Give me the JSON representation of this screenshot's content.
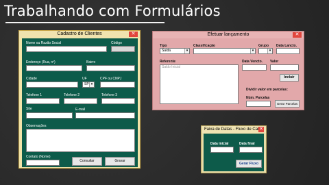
{
  "page": {
    "title": "Trabalhando com Formulários"
  },
  "cadastro": {
    "title": "Cadastro de Clientes",
    "close": "✕",
    "labels": {
      "nome": "Nome ou Razão Social",
      "codigo": "Código",
      "endereco": "Endereço (Rua, nº)",
      "bairro": "Bairro",
      "cidade": "Cidade",
      "uf": "UF",
      "cpf": "CPF ou CNPJ",
      "tel1": "Telefone 1",
      "tel2": "Telefone 2",
      "tel3": "Telefone 3",
      "site": "Site",
      "email": "E-mail",
      "obs": "Observações",
      "contato": "Contato (Nome)"
    },
    "uf_value": "SP",
    "buttons": {
      "consultar": "Consultar",
      "gravar": "Gravar"
    }
  },
  "lancamento": {
    "title": "Efetuar lançamento",
    "close": "✕",
    "labels": {
      "tipo": "Tipo",
      "classificacao": "Classificação",
      "grupo": "Grupo",
      "data_lancto": "Data Lancto.",
      "referente": "Referente",
      "data_vencto": "Data Vencto.",
      "valor": "Valor",
      "dividir": "Dividir valor em parcelas:",
      "num_parcelas": "Núm. Parcelas"
    },
    "tipo_value": "Saída",
    "list_item": "Saldo Inicial",
    "buttons": {
      "incluir": "Incluir",
      "gerar_parcelas": "Gerar Parcelas"
    }
  },
  "fluxo": {
    "title": "Faixa de Datas - Fluxo de Caixa",
    "close": "✕",
    "labels": {
      "data_inicial": "Data inicial",
      "data_final": "Data final"
    },
    "buttons": {
      "gerar_fluxo": "Gerar Fluxo"
    }
  }
}
